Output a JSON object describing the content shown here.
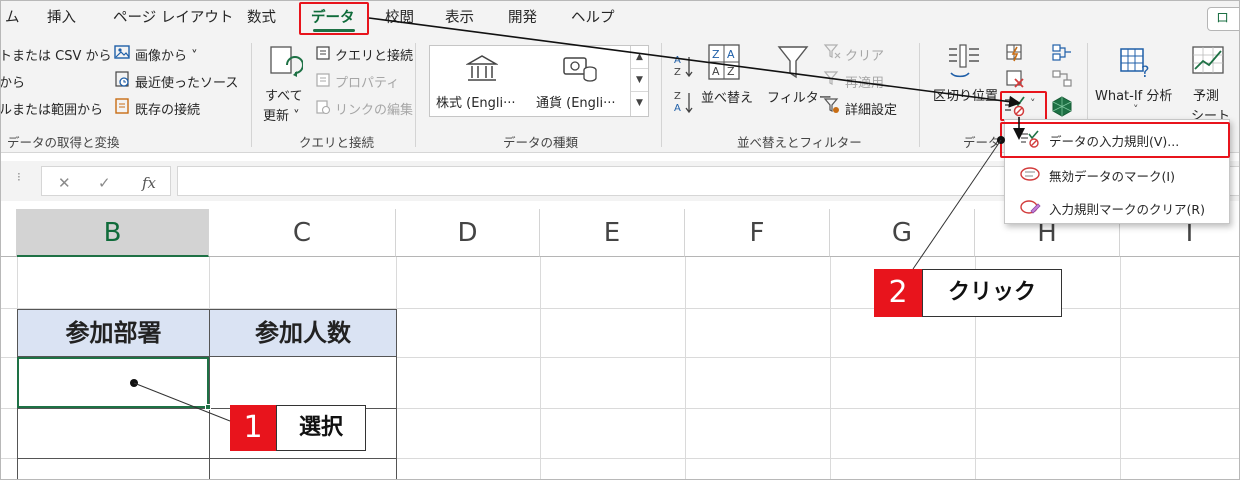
{
  "tabs": [
    "ム",
    "挿入",
    "ページ レイアウト",
    "数式",
    "データ",
    "校閲",
    "表示",
    "開発",
    "ヘルプ"
  ],
  "share_label": "ロ",
  "ribbon": {
    "get_data": {
      "items": [
        "トまたは CSV から",
        "から",
        "ルまたは範囲から"
      ],
      "image": "画像から",
      "recent": "最近使ったソース",
      "existing": "既存の接続",
      "label": "データの取得と変換"
    },
    "queries": {
      "refresh_all": "すべて",
      "refresh_all2": "更新",
      "queries_conn": "クエリと接続",
      "properties": "プロパティ",
      "edit_links": "リンクの編集",
      "label": "クエリと接続"
    },
    "types": {
      "stocks": "株式 (Engli···",
      "currency": "通貨 (Engli···",
      "label": "データの種類"
    },
    "sort": {
      "sort": "並べ替え",
      "filter": "フィルター",
      "clear": "クリア",
      "reapply": "再適用",
      "advanced": "詳細設定",
      "label": "並べ替えとフィルター"
    },
    "tools": {
      "text_to_columns": "区切り位置",
      "label": "データ"
    },
    "forecast": {
      "whatif": "What-If 分析",
      "forecast1": "予測",
      "forecast2": "シート"
    }
  },
  "dropdown": {
    "items": [
      "データの入力規則(V)...",
      "無効データのマーク(I)",
      "入力規則マークのクリア(R)"
    ]
  },
  "formula": {
    "cancel": "✕",
    "enter": "✓",
    "fx": "fx"
  },
  "columns": [
    "B",
    "C",
    "D",
    "E",
    "F",
    "G",
    "H",
    "I"
  ],
  "table": {
    "headers": [
      "参加部署",
      "参加人数"
    ]
  },
  "callouts": [
    {
      "num": "1",
      "text": "選択"
    },
    {
      "num": "2",
      "text": "クリック"
    }
  ],
  "colors": {
    "accent": "#1e7145",
    "highlight": "#e8141c",
    "header_fill": "#dae3f3"
  }
}
